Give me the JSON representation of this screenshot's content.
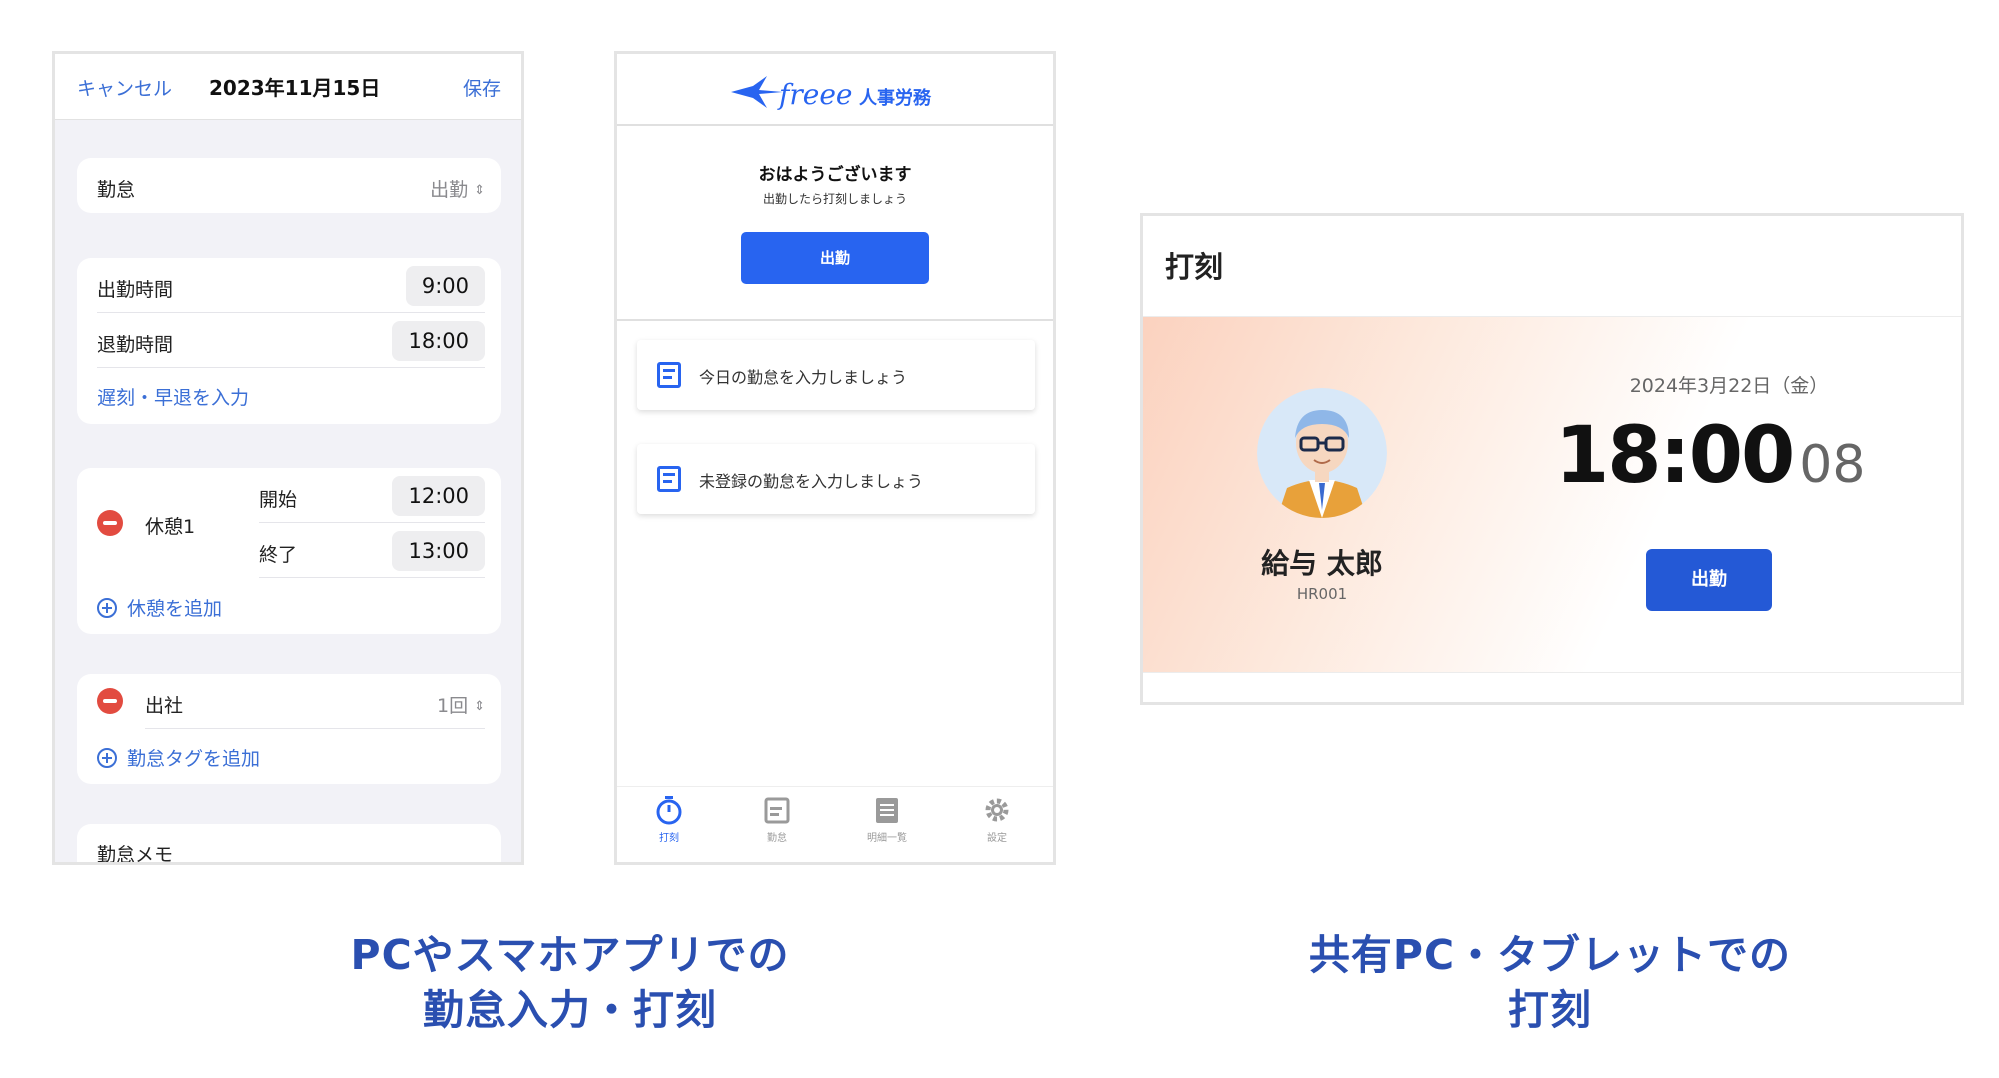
{
  "edit_form": {
    "cancel": "キャンセル",
    "date": "2023年11月15日",
    "save": "保存",
    "attendance_label": "勤怠",
    "attendance_value": "出勤",
    "start_label": "出勤時間",
    "start_value": "9:00",
    "end_label": "退勤時間",
    "end_value": "18:00",
    "late_link": "遅刻・早退を入力",
    "break_name": "休憩1",
    "break_start_label": "開始",
    "break_start_value": "12:00",
    "break_end_label": "終了",
    "break_end_value": "13:00",
    "add_break": "休憩を追加",
    "tag_name": "出社",
    "tag_value": "1回",
    "add_tag": "勤怠タグを追加",
    "memo_label": "勤怠メモ"
  },
  "mobile_app": {
    "logo_mark": "freee",
    "logo_text": "人事労務",
    "greeting": "おはようございます",
    "greeting_sub": "出勤したら打刻しましょう",
    "clock_in": "出勤",
    "tasks": [
      "今日の勤怠を入力しましょう",
      "未登録の勤怠を入力しましょう"
    ],
    "tabs": [
      "打刻",
      "勤怠",
      "明細一覧",
      "設定"
    ]
  },
  "kiosk": {
    "title": "打刻",
    "user_name": "給与 太郎",
    "user_id": "HR001",
    "date": "2024年3月22日（金）",
    "time": "18:00",
    "seconds": "08",
    "clock_in": "出勤"
  },
  "captions": {
    "left_line1": "PCやスマホアプリでの",
    "left_line2": "勤怠入力・打刻",
    "right_line1": "共有PC・タブレットでの",
    "right_line2": "打刻"
  },
  "colors": {
    "brand_blue": "#2864f0",
    "caption_blue": "#2a4fb0",
    "link_blue": "#3b6fd6",
    "delete_red": "#e24b40"
  }
}
